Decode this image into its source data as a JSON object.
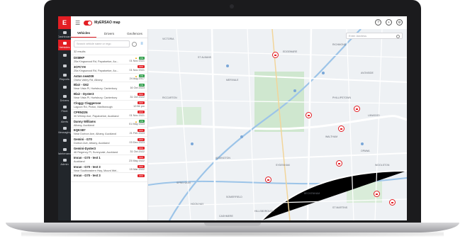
{
  "app": {
    "logo": "E",
    "title": "MyERSAO map",
    "top_icons": [
      "help-icon",
      "clock-icon",
      "settings-icon"
    ]
  },
  "leftnav": {
    "items": [
      {
        "label": "Dashboard",
        "icon": "grid-icon"
      },
      {
        "label": "Vehicles",
        "icon": "truck-icon",
        "active": true
      },
      {
        "label": "",
        "icon": "person-icon"
      },
      {
        "label": "",
        "icon": "pin-icon"
      },
      {
        "label": "Reports",
        "icon": "chart-icon"
      },
      {
        "label": "",
        "icon": "calendar-icon"
      },
      {
        "label": "Drivers",
        "icon": "id-icon"
      },
      {
        "label": "Fleet",
        "icon": "car-icon"
      },
      {
        "label": "Alerts",
        "icon": "bell-icon"
      },
      {
        "label": "Messaging",
        "icon": "chat-icon"
      },
      {
        "label": "",
        "icon": "doc-icon"
      },
      {
        "label": "Maintenance",
        "icon": "wrench-icon"
      },
      {
        "label": "Admin",
        "icon": "gear-icon"
      }
    ]
  },
  "panel": {
    "tabs": [
      "Vehicles",
      "Drivers",
      "Geofences"
    ],
    "search_placeholder": "Search vehicle name or rego",
    "results": "32 results",
    "vehicles": [
      {
        "name": "DXMHP",
        "addr": "25a Kingswood Rd, Papatoetoe, Au...",
        "date": "01 Nov 2021",
        "badge": "ON",
        "badge_color": "#2e9e49",
        "warn": true
      },
      {
        "name": "3CFCYH",
        "addr": "25a Kingswood Rd, Papatoetoe, Au...",
        "date": "01 Nov 2021",
        "badge": "OFF",
        "badge_color": "#e31e24",
        "warn": false
      },
      {
        "name": "Aston new009",
        "addr": "Olaha Valley Rd, Albany",
        "date": "24 Aug 2017",
        "badge": "ON",
        "badge_color": "#2e9e49",
        "warn": true
      },
      {
        "name": "Blair - G62",
        "addr": "Near Vista Pl, Hurtsbury, Canterbury",
        "date": "16 Oct 2023",
        "badge": "ON",
        "badge_color": "#2e9e49",
        "warn": false
      },
      {
        "name": "Blair - Dyster3",
        "addr": "Near Vista Pl, Hurtsbury, Canterbury",
        "date": "31 Oct 2022",
        "badge": "OFF",
        "badge_color": "#e31e24",
        "warn": false
      },
      {
        "name": "Cloggy Claggerose",
        "addr": "Lagoon Rd, Picton, Marlborough",
        "date": "12:56 pm",
        "badge": "OFF",
        "badge_color": "#e31e24",
        "warn": false
      },
      {
        "name": "CPRN22N",
        "addr": "30 Whimp Ave, Papatoetoe, Auckland",
        "date": "01 Nov 2021",
        "badge": "OFF",
        "badge_color": "#e31e24",
        "warn": false
      },
      {
        "name": "Danny Williams",
        "addr": "Albany, Auckland",
        "date": "01 May 2023",
        "badge": "ON",
        "badge_color": "#2e9e49",
        "warn": true
      },
      {
        "name": "EQKS87",
        "addr": "Near Dorbon Ave, Albany, Auckland",
        "date": "21 Feb 2023",
        "badge": "OFF",
        "badge_color": "#e31e24",
        "warn": false
      },
      {
        "name": "Gemini - G70",
        "addr": "Dorbon Ave, Albany, Auckland",
        "date": "03 Dec 2023",
        "badge": "OFF",
        "badge_color": "#e31e24",
        "warn": false
      },
      {
        "name": "Gemini-Dyster3",
        "addr": "46 Regency Pl, Sunnyvale, Auckland",
        "date": "31 Oct 2022",
        "badge": "OFF",
        "badge_color": "#e31e24",
        "warn": false
      },
      {
        "name": "Imran - G70 - test 1",
        "addr": "Auckland",
        "date": "23 May 2022",
        "badge": "OFF",
        "badge_color": "#e31e24",
        "warn": false
      },
      {
        "name": "Imran - G70 - test 3",
        "addr": "Near Southeastern Hwy, Mount Wel...",
        "date": "15 Mar 2022",
        "badge": "OFF",
        "badge_color": "#e31e24",
        "warn": false
      },
      {
        "name": "Imran - G70 - test 3",
        "addr": "",
        "date": "",
        "badge": "OFF",
        "badge_color": "#e31e24",
        "warn": false
      }
    ]
  },
  "map": {
    "search_placeholder": "Enter Address",
    "labels": [
      "VICTORIA",
      "ST ALBANS",
      "MERIVALE",
      "RICCARTON",
      "ADDINGTON",
      "SPREYDON",
      "LINWOOD",
      "PHILLIPSTOWN",
      "WALTHAM",
      "OPAWA",
      "SYDENHAM",
      "EDGEWARE",
      "RICHMOND",
      "AVONSIDE",
      "WOOLSTON",
      "HOON HAY",
      "BECKENHAM",
      "ST MARTINS",
      "HILLSBOROUGH",
      "SOMERFIELD",
      "CASHMERE"
    ]
  },
  "colors": {
    "brand": "#e31e24",
    "on": "#2e9e49",
    "nav": "#22262b"
  }
}
